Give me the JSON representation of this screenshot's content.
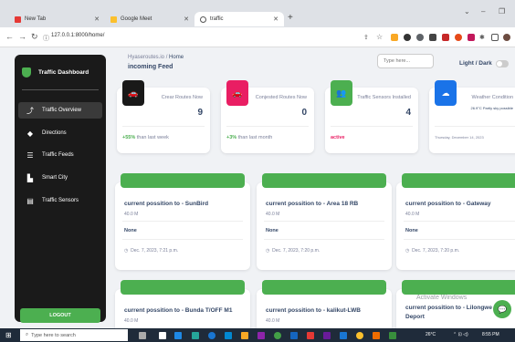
{
  "browser": {
    "tabs": [
      {
        "label": "New Tab",
        "color": "#e53935"
      },
      {
        "label": "Google Meet",
        "color": "#fbc02d"
      },
      {
        "label": "traffic",
        "color": "#555555"
      }
    ],
    "new_tab": "+",
    "url": "127.0.0.1:8000/home/",
    "win_controls": [
      "⌄",
      "–",
      "❐"
    ]
  },
  "sidebar": {
    "brand": "Traffic Dashboard",
    "items": [
      {
        "label": "Traffic Overview",
        "icon": "⤴"
      },
      {
        "label": "Directions",
        "icon": "◆"
      },
      {
        "label": "Traffic Feeds",
        "icon": "☰"
      },
      {
        "label": "Smart City",
        "icon": "▙"
      },
      {
        "label": "Traffic Sensors",
        "icon": "▤"
      }
    ],
    "logout": "LOGOUT"
  },
  "header": {
    "crumb_root": "Hyaseroutes.io",
    "crumb_sep": "/",
    "crumb_page": "Home",
    "title": "incoming Feed",
    "search_placeholder": "Type here...",
    "theme_label": "Light / Dark"
  },
  "stats": [
    {
      "label": "Crear Routes Now",
      "value": "9",
      "foot_strong": "+55%",
      "foot_rest": " than last week",
      "color": "#191919",
      "icon": "🚗"
    },
    {
      "label": "Conjested Routes Now",
      "value": "0",
      "foot_strong": "+3%",
      "foot_rest": " than last month",
      "color": "#e91e63",
      "icon": "🚗"
    },
    {
      "label": "Traffic Sensors Installed",
      "value": "4",
      "foot_strong": "active",
      "foot_rest": "",
      "color": "#4caf50",
      "icon": "👥"
    },
    {
      "label": "Weather Condition",
      "sub": "26.9°C Partly sky possible",
      "foot_rest": "Thursday, December 14, 2023",
      "color": "#1a73e8",
      "icon": "☁"
    }
  ],
  "routes": [
    {
      "title": "current possition to - SunBird",
      "dist": "40.0 M",
      "status": "None",
      "time": "Dec. 7, 2023, 7:21 p.m."
    },
    {
      "title": "current possition to - Area 18 RB",
      "dist": "40.0 M",
      "status": "None",
      "time": "Dec. 7, 2023, 7:20 p.m."
    },
    {
      "title": "current possition to - Gateway",
      "dist": "40.0 M",
      "status": "None",
      "time": "Dec. 7, 2023, 7:20 p.m."
    },
    {
      "title": "current possition to - Bunda T/OFF M1",
      "dist": "40.0 M"
    },
    {
      "title": "current possition to - kalikut-LWB",
      "dist": "40.0 M"
    },
    {
      "title": "current possition to - Lilongwe Bus Deport",
      "dist": ""
    }
  ],
  "watermark": "Activate Windows",
  "taskbar": {
    "search": "Type here to search",
    "weather": "26°C",
    "time": "8:55 PM"
  }
}
